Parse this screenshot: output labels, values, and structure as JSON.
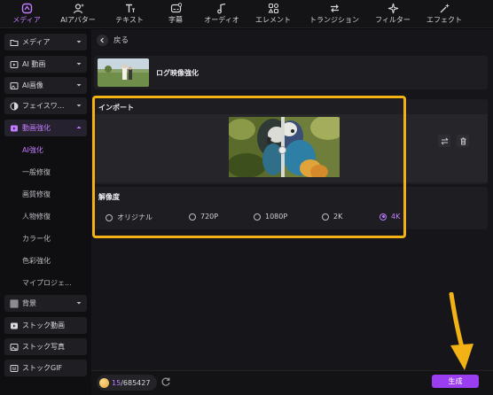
{
  "toolbar": {
    "items": [
      {
        "label": "メディア",
        "icon": "media-icon",
        "active": true
      },
      {
        "label": "AIアバター",
        "icon": "ai-avatar-icon"
      },
      {
        "label": "テキスト",
        "icon": "text-icon"
      },
      {
        "label": "字幕",
        "icon": "subtitle-icon"
      },
      {
        "label": "オーディオ",
        "icon": "audio-icon"
      },
      {
        "label": "エレメント",
        "icon": "element-icon"
      },
      {
        "label": "トランジション",
        "icon": "transition-icon"
      },
      {
        "label": "フィルター",
        "icon": "filter-icon"
      },
      {
        "label": "エフェクト",
        "icon": "effect-icon"
      }
    ]
  },
  "sidebar": {
    "items": [
      {
        "label": "メディア",
        "icon": "folder-icon"
      },
      {
        "label": "AI 動画",
        "icon": "ai-video-icon"
      },
      {
        "label": "AI画像",
        "icon": "ai-image-icon"
      },
      {
        "label": "フェイスワ...",
        "icon": "face-swap-icon"
      },
      {
        "label": "動画強化",
        "icon": "video-enhance-icon"
      },
      {
        "label": "背景",
        "icon": "background-icon"
      },
      {
        "label": "ストック動画",
        "icon": "stock-video-icon"
      },
      {
        "label": "ストック写真",
        "icon": "stock-photo-icon"
      },
      {
        "label": "ストックGIF",
        "icon": "stock-gif-icon"
      }
    ],
    "sub_items": [
      "AI強化",
      "一般修復",
      "画質修復",
      "人物修復",
      "カラー化",
      "色彩強化",
      "マイプロジェ..."
    ]
  },
  "main": {
    "back_label": "戻る",
    "feature_title": "ログ映像強化",
    "import_label": "インポート",
    "resolution_label": "解像度",
    "resolution_options": [
      "オリジナル",
      "720P",
      "1080P",
      "2K",
      "4K"
    ],
    "selected_resolution": "4K"
  },
  "bottom": {
    "credits_current": "15",
    "credits_total": "/685427",
    "generate_label": "生成"
  },
  "colors": {
    "accent": "#c17cff",
    "generate_button": "#9b3df0",
    "highlight_box": "#f2b216"
  }
}
